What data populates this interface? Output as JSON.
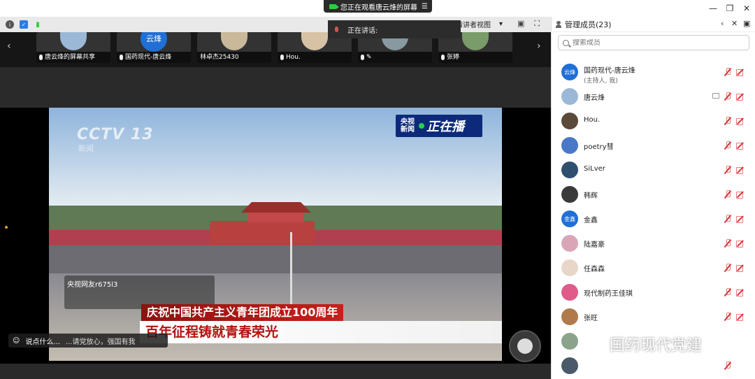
{
  "window": {
    "share_banner": "您正在观看唐云烽的屏幕",
    "minimize": "—",
    "maximize": "❐",
    "close": "✕"
  },
  "toolbar": {
    "speaking_label": "正在讲话:",
    "presenter_view": "演讲者视图",
    "dropdown_arrow": "▾"
  },
  "thumbnails": [
    {
      "name": "唐云烽的屏幕共享",
      "avatar_color": "#9bb8d6"
    },
    {
      "name": "国药现代-唐云烽",
      "avatar_text": "云烽",
      "avatar_color": "#1f6fd6"
    },
    {
      "name": "林卓杰25430",
      "avatar_color": "#c9b89a"
    },
    {
      "name": "Hou.",
      "avatar_color": "#d7c2a5"
    },
    {
      "name": "",
      "avatar_color": "#8899a0"
    },
    {
      "name": "张婷",
      "avatar_color": "#7a9b6a"
    }
  ],
  "video": {
    "channel_logo": "CCTV 13",
    "channel_sub": "新闻",
    "live_org": "央视新闻",
    "live_text": "正在播",
    "danmu_user": "央视网友r675l3",
    "caption_top": "庆祝中国共产主义青年团成立100周年",
    "caption_main": "百年征程铸就青春荣光"
  },
  "chat": {
    "placeholder": "说点什么...",
    "ticker": "...请党放心，强国有我"
  },
  "panel": {
    "title": "管理成员(23)",
    "search_placeholder": "搜索成员",
    "members": [
      {
        "name": "国药现代-唐云烽",
        "sub": "(主持人, 我)",
        "avatar_text": "云烽",
        "avatar_color": "#1f6fd6"
      },
      {
        "name": "唐云烽",
        "avatar_color": "#9bb8d6",
        "sharing": true
      },
      {
        "name": "Hou.",
        "avatar_color": "#5b4a3a"
      },
      {
        "name": "poetry彗",
        "avatar_color": "#4a78c8"
      },
      {
        "name": "SiLver",
        "avatar_color": "#2f4f6f"
      },
      {
        "name": "韩辉",
        "avatar_color": "#3a3a3a"
      },
      {
        "name": "金鑫",
        "avatar_text": "金鑫",
        "avatar_color": "#1f6fd6"
      },
      {
        "name": "陆嘉豪",
        "avatar_color": "#d9a6b8"
      },
      {
        "name": "任森森",
        "avatar_color": "#e8d7c9"
      },
      {
        "name": "现代制药王佳琪",
        "avatar_color": "#e05a8a"
      },
      {
        "name": "张旺",
        "avatar_color": "#b07a4a"
      },
      {
        "name": "",
        "avatar_color": "#8aa38a"
      },
      {
        "name": "",
        "avatar_color": "#4a5a6a"
      }
    ]
  },
  "watermark": "国药现代党建",
  "colors": {
    "accent": "#1f6fd6",
    "mic_off": "#d33333",
    "caption_red": "#c81f1b"
  }
}
